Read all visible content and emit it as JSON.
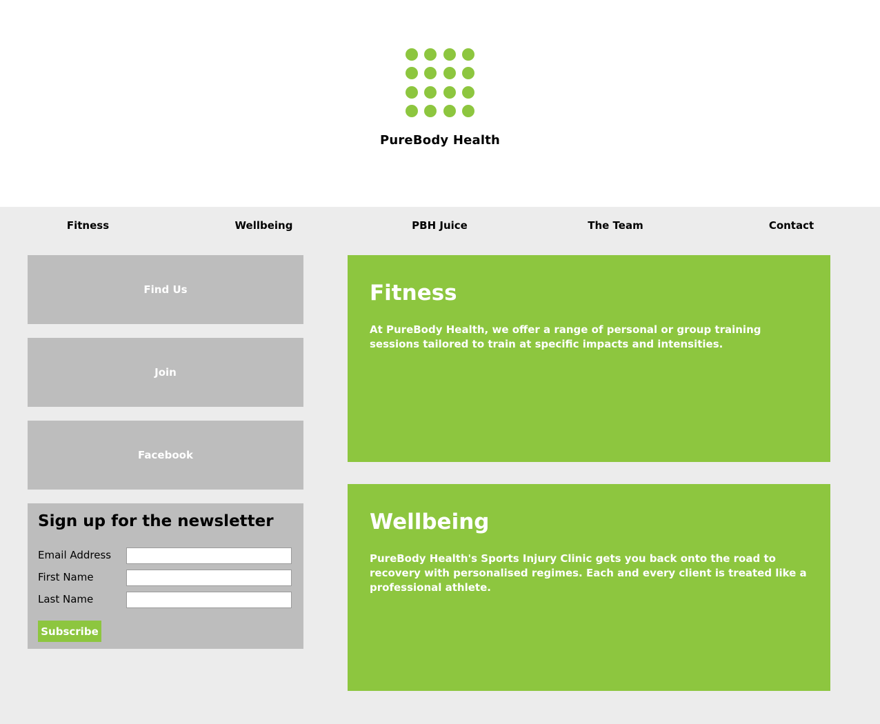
{
  "brand": {
    "name": "PureBody Health",
    "logo_icon": "dot-grid-logo-icon",
    "accent_color": "#8dc63f"
  },
  "nav": {
    "items": [
      {
        "label": "Fitness"
      },
      {
        "label": "Wellbeing"
      },
      {
        "label": "PBH Juice"
      },
      {
        "label": "The Team"
      },
      {
        "label": "Contact"
      }
    ]
  },
  "sidebar": {
    "buttons": [
      {
        "label": "Find Us"
      },
      {
        "label": "Join"
      },
      {
        "label": "Facebook"
      }
    ],
    "button_color": "#bdbdbd"
  },
  "newsletter": {
    "title": "Sign up for the newsletter",
    "fields": [
      {
        "label": "Email Address",
        "value": "",
        "placeholder": ""
      },
      {
        "label": "First Name",
        "value": "",
        "placeholder": ""
      },
      {
        "label": "Last Name",
        "value": "",
        "placeholder": ""
      }
    ],
    "subscribe_label": "Subscribe"
  },
  "cards": [
    {
      "title": "Fitness",
      "text": "At PureBody Health, we offer a range of personal or group training sessions tailored to train at specific impacts and intensities."
    },
    {
      "title": "Wellbeing",
      "text": "PureBody Health's Sports Injury Clinic gets you back onto the road to recovery with personalised regimes. Each and every client is treated like a professional athlete."
    }
  ]
}
